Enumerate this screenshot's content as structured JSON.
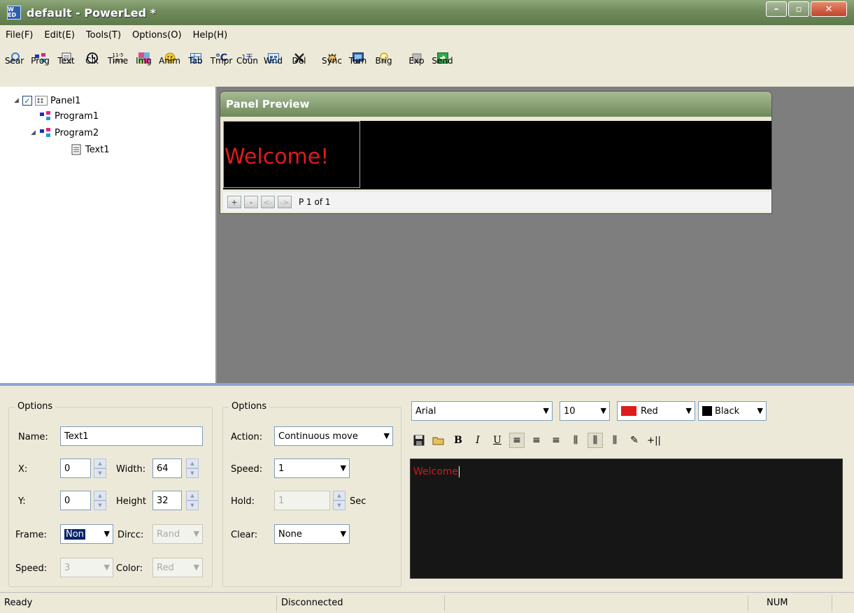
{
  "window": {
    "title": "default - PowerLed *",
    "app_icon_text": "W ED"
  },
  "menu": [
    "File(F)",
    "Edit(E)",
    "Tools(T)",
    "Options(O)",
    "Help(H)"
  ],
  "toolbar": [
    {
      "label": "Sear",
      "icon": "search-icon"
    },
    {
      "label": "Prog",
      "icon": "program-icon"
    },
    {
      "label": "Text",
      "icon": "text-icon"
    },
    {
      "label": "Clk",
      "icon": "clock-icon"
    },
    {
      "label": "Time",
      "icon": "time-icon",
      "glyph": "11-5 18:3"
    },
    {
      "label": "Img",
      "icon": "image-icon"
    },
    {
      "label": "Anim",
      "icon": "animation-icon"
    },
    {
      "label": "Tab",
      "icon": "table-icon"
    },
    {
      "label": "Tmpr",
      "icon": "temperature-icon",
      "glyph": "℃"
    },
    {
      "label": "Coun",
      "icon": "count-icon",
      "glyph": "1天"
    },
    {
      "label": "Wnd",
      "icon": "window-icon"
    },
    {
      "label": "Del",
      "icon": "delete-icon"
    },
    {
      "label": "Sync",
      "icon": "sync-icon"
    },
    {
      "label": "Turn",
      "icon": "turn-icon"
    },
    {
      "label": "Brig",
      "icon": "brightness-icon"
    },
    {
      "label": "Exp",
      "icon": "export-icon"
    },
    {
      "label": "Send",
      "icon": "send-icon"
    }
  ],
  "tree": {
    "panel": "Panel1",
    "program1": "Program1",
    "program2": "Program2",
    "text1": "Text1"
  },
  "preview": {
    "title": "Panel Preview",
    "led_text": "Welcome!",
    "page_info": "P 1 of 1",
    "buttons": [
      "+",
      "-",
      "<-",
      "->"
    ]
  },
  "options_left": {
    "title": "Options",
    "name_label": "Name:",
    "name_value": "Text1",
    "x_label": "X:",
    "x_value": "0",
    "width_label": "Width:",
    "width_value": "64",
    "y_label": "Y:",
    "y_value": "0",
    "height_label": "Height",
    "height_value": "32",
    "frame_label": "Frame:",
    "frame_value": "Non",
    "dircc_label": "Dircc:",
    "dircc_value": "Rand",
    "speed_label": "Speed:",
    "speed_value": "3",
    "color_label": "Color:",
    "color_value": "Red"
  },
  "options_right": {
    "title": "Options",
    "action_label": "Action:",
    "action_value": "Continuous move",
    "speed_label": "Speed:",
    "speed_value": "1",
    "hold_label": "Hold:",
    "hold_value": "1",
    "hold_unit": "Sec",
    "clear_label": "Clear:",
    "clear_value": "None"
  },
  "text_editor": {
    "font": "Arial",
    "size": "10",
    "fg_color_name": "Red",
    "fg_color": "#e01b1b",
    "bg_color_name": "Black",
    "bg_color": "#000000",
    "content": "Welcome"
  },
  "status": {
    "ready": "Ready",
    "connection": "Disconnected",
    "num": "NUM"
  }
}
